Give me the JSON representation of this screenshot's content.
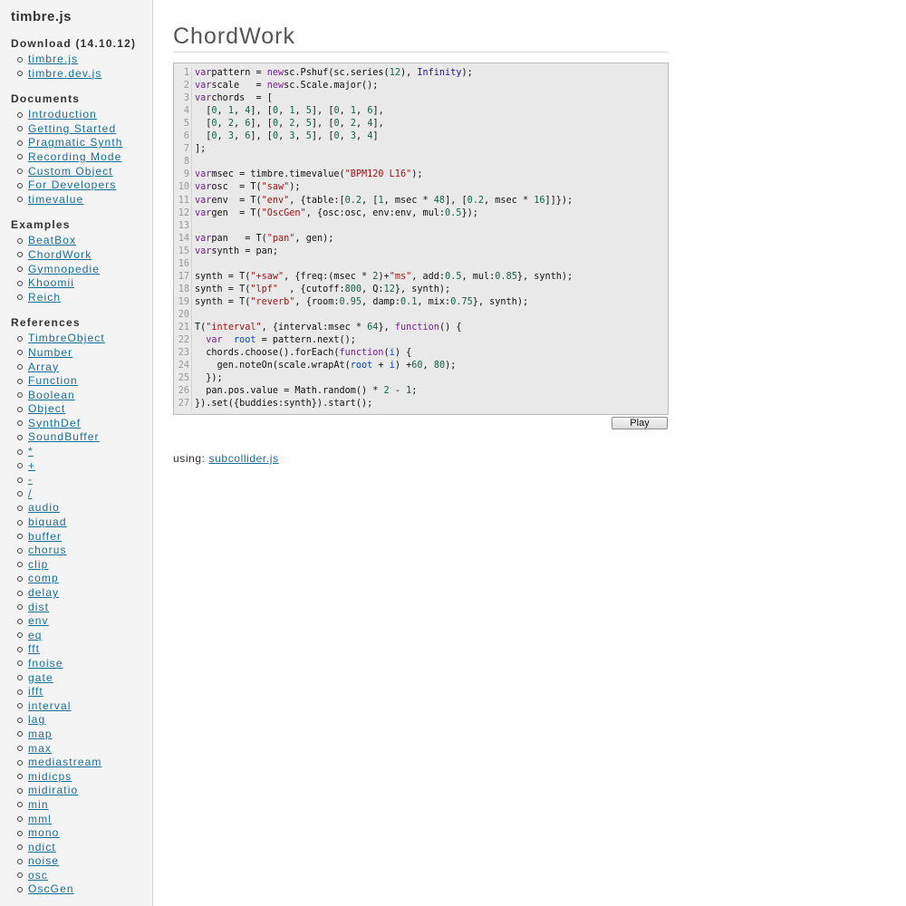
{
  "sidebar": {
    "title": "timbre.js",
    "sections": [
      {
        "heading": "Download (14.10.12)",
        "items": [
          "timbre.js",
          "timbre.dev.js"
        ]
      },
      {
        "heading": "Documents",
        "items": [
          "Introduction",
          "Getting Started",
          "Pragmatic Synth",
          "Recording Mode",
          "Custom Object",
          "For Developers",
          "timevalue"
        ]
      },
      {
        "heading": "Examples",
        "items": [
          "BeatBox",
          "ChordWork",
          "Gymnopedie",
          "Khoomii",
          "Reich"
        ]
      },
      {
        "heading": "References",
        "items": [
          "TimbreObject",
          "Number",
          "Array",
          "Function",
          "Boolean",
          "Object",
          "SynthDef",
          "SoundBuffer",
          "*",
          "+",
          "-",
          "/",
          "audio",
          "biquad",
          "buffer",
          "chorus",
          "clip",
          "comp",
          "delay",
          "dist",
          "env",
          "eq",
          "fft",
          "fnoise",
          "gate",
          "ifft",
          "interval",
          "lag",
          "map",
          "max",
          "mediastream",
          "midicps",
          "midiratio",
          "min",
          "mml",
          "mono",
          "ndict",
          "noise",
          "osc",
          "OscGen"
        ]
      }
    ]
  },
  "main": {
    "title": "ChordWork",
    "play_label": "Play",
    "using_label": "using:",
    "using_link": "subcollider.js"
  },
  "code": [
    [
      [
        "kw",
        "var"
      ],
      [
        "",
        "pattern = "
      ],
      [
        "kw",
        "new"
      ],
      [
        "",
        "sc.Pshuf(sc.series("
      ],
      [
        "num",
        "12"
      ],
      [
        "",
        "), "
      ],
      [
        "atom",
        "Infinity"
      ],
      [
        "",
        ");"
      ]
    ],
    [
      [
        "kw",
        "var"
      ],
      [
        "",
        "scale   = "
      ],
      [
        "kw",
        "new"
      ],
      [
        "",
        "sc.Scale.major();"
      ]
    ],
    [
      [
        "kw",
        "var"
      ],
      [
        "",
        "chords  = ["
      ]
    ],
    [
      [
        "",
        "  ["
      ],
      [
        "num",
        "0"
      ],
      [
        "",
        ", "
      ],
      [
        "num",
        "1"
      ],
      [
        "",
        ", "
      ],
      [
        "num",
        "4"
      ],
      [
        "",
        "], ["
      ],
      [
        "num",
        "0"
      ],
      [
        "",
        ", "
      ],
      [
        "num",
        "1"
      ],
      [
        "",
        ", "
      ],
      [
        "num",
        "5"
      ],
      [
        "",
        "], ["
      ],
      [
        "num",
        "0"
      ],
      [
        "",
        ", "
      ],
      [
        "num",
        "1"
      ],
      [
        "",
        ", "
      ],
      [
        "num",
        "6"
      ],
      [
        "",
        "],"
      ]
    ],
    [
      [
        "",
        "  ["
      ],
      [
        "num",
        "0"
      ],
      [
        "",
        ", "
      ],
      [
        "num",
        "2"
      ],
      [
        "",
        ", "
      ],
      [
        "num",
        "6"
      ],
      [
        "",
        "], ["
      ],
      [
        "num",
        "0"
      ],
      [
        "",
        ", "
      ],
      [
        "num",
        "2"
      ],
      [
        "",
        ", "
      ],
      [
        "num",
        "5"
      ],
      [
        "",
        "], ["
      ],
      [
        "num",
        "0"
      ],
      [
        "",
        ", "
      ],
      [
        "num",
        "2"
      ],
      [
        "",
        ", "
      ],
      [
        "num",
        "4"
      ],
      [
        "",
        "],"
      ]
    ],
    [
      [
        "",
        "  ["
      ],
      [
        "num",
        "0"
      ],
      [
        "",
        ", "
      ],
      [
        "num",
        "3"
      ],
      [
        "",
        ", "
      ],
      [
        "num",
        "6"
      ],
      [
        "",
        "], ["
      ],
      [
        "num",
        "0"
      ],
      [
        "",
        ", "
      ],
      [
        "num",
        "3"
      ],
      [
        "",
        ", "
      ],
      [
        "num",
        "5"
      ],
      [
        "",
        "], ["
      ],
      [
        "num",
        "0"
      ],
      [
        "",
        ", "
      ],
      [
        "num",
        "3"
      ],
      [
        "",
        ", "
      ],
      [
        "num",
        "4"
      ],
      [
        "",
        "]"
      ]
    ],
    [
      [
        "",
        "];"
      ]
    ],
    [],
    [
      [
        "kw",
        "var"
      ],
      [
        "",
        "msec = timbre.timevalue("
      ],
      [
        "str",
        "\"BPM120 L16\""
      ],
      [
        "",
        ");"
      ]
    ],
    [
      [
        "kw",
        "var"
      ],
      [
        "",
        "osc  = T("
      ],
      [
        "str",
        "\"saw\""
      ],
      [
        "",
        ");"
      ]
    ],
    [
      [
        "kw",
        "var"
      ],
      [
        "",
        "env  = T("
      ],
      [
        "str",
        "\"env\""
      ],
      [
        "",
        ", {table:["
      ],
      [
        "num",
        "0.2"
      ],
      [
        "",
        ", ["
      ],
      [
        "num",
        "1"
      ],
      [
        "",
        ", msec * "
      ],
      [
        "num",
        "48"
      ],
      [
        "",
        "], ["
      ],
      [
        "num",
        "0.2"
      ],
      [
        "",
        ", msec * "
      ],
      [
        "num",
        "16"
      ],
      [
        "",
        "]]});"
      ]
    ],
    [
      [
        "kw",
        "var"
      ],
      [
        "",
        "gen  = T("
      ],
      [
        "str",
        "\"OscGen\""
      ],
      [
        "",
        ", {osc:osc, env:env, mul:"
      ],
      [
        "num",
        "0.5"
      ],
      [
        "",
        "});"
      ]
    ],
    [],
    [
      [
        "kw",
        "var"
      ],
      [
        "",
        "pan   = T("
      ],
      [
        "str",
        "\"pan\""
      ],
      [
        "",
        ", gen);"
      ]
    ],
    [
      [
        "kw",
        "var"
      ],
      [
        "",
        "synth = pan;"
      ]
    ],
    [],
    [
      [
        "",
        "synth = T("
      ],
      [
        "str",
        "\"+saw\""
      ],
      [
        "",
        ", {freq:(msec * "
      ],
      [
        "num",
        "2"
      ],
      [
        "",
        ")+"
      ],
      [
        "str",
        "\"ms\""
      ],
      [
        "",
        ", add:"
      ],
      [
        "num",
        "0.5"
      ],
      [
        "",
        ", mul:"
      ],
      [
        "num",
        "0.85"
      ],
      [
        "",
        "}, synth);"
      ]
    ],
    [
      [
        "",
        "synth = T("
      ],
      [
        "str",
        "\"lpf\""
      ],
      [
        "",
        "  , {cutoff:"
      ],
      [
        "num",
        "800"
      ],
      [
        "",
        ", Q:"
      ],
      [
        "num",
        "12"
      ],
      [
        "",
        "}, synth);"
      ]
    ],
    [
      [
        "",
        "synth = T("
      ],
      [
        "str",
        "\"reverb\""
      ],
      [
        "",
        ", {room:"
      ],
      [
        "num",
        "0.95"
      ],
      [
        "",
        ", damp:"
      ],
      [
        "num",
        "0.1"
      ],
      [
        "",
        ", mix:"
      ],
      [
        "num",
        "0.75"
      ],
      [
        "",
        "}, synth);"
      ]
    ],
    [],
    [
      [
        "",
        "T("
      ],
      [
        "str",
        "\"interval\""
      ],
      [
        "",
        ", {interval:msec * "
      ],
      [
        "num",
        "64"
      ],
      [
        "",
        "}, "
      ],
      [
        "kw",
        "function"
      ],
      [
        "",
        "() {"
      ]
    ],
    [
      [
        "",
        "  "
      ],
      [
        "kw",
        "var"
      ],
      [
        "",
        "  "
      ],
      [
        "var",
        "root"
      ],
      [
        "",
        " = pattern.next();"
      ]
    ],
    [
      [
        "",
        "  chords.choose().forEach("
      ],
      [
        "kw",
        "function"
      ],
      [
        "",
        "("
      ],
      [
        "var",
        "i"
      ],
      [
        "",
        ") {"
      ]
    ],
    [
      [
        "",
        "    gen.noteOn(scale.wrapAt("
      ],
      [
        "var",
        "root"
      ],
      [
        "",
        " + "
      ],
      [
        "var",
        "i"
      ],
      [
        "",
        ") +"
      ],
      [
        "num",
        "60"
      ],
      [
        "",
        ", "
      ],
      [
        "num",
        "80"
      ],
      [
        "",
        ");"
      ]
    ],
    [
      [
        "",
        "  });"
      ]
    ],
    [
      [
        "",
        "  pan.pos.value = Math.random() * "
      ],
      [
        "num",
        "2"
      ],
      [
        "",
        " - "
      ],
      [
        "num",
        "1"
      ],
      [
        "",
        ";"
      ]
    ],
    [
      [
        "",
        "}).set({buddies:synth}).start();"
      ]
    ]
  ]
}
